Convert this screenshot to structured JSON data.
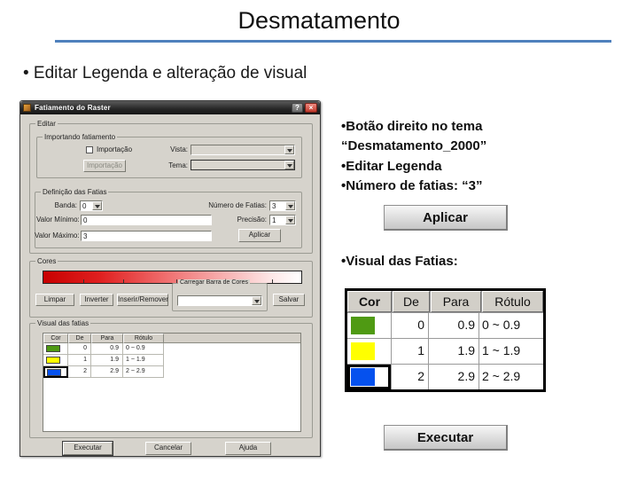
{
  "slide": {
    "title": "Desmatamento",
    "bullet": "• Editar Legenda e alteração de visual"
  },
  "colors": {
    "accent": "#4f81bd",
    "close_button_red": "#c0392b",
    "ramp_start": "#c80000",
    "ramp_end": "#ffffff"
  },
  "dialog": {
    "title": "Fatiamento do Raster",
    "help_label": "?",
    "close_label": "×",
    "groups": {
      "editar": "Editar",
      "importando": "Importando fatiamento",
      "definicao": "Definição das Fatias",
      "cores": "Cores",
      "carregar": "Carregar Barra de Cores",
      "visual": "Visual das fatias"
    },
    "importar": {
      "checkbox_label": "Importação",
      "button_label": "Importação",
      "vista_label": "Vista:",
      "vista_value": "",
      "tema_label": "Tema:",
      "tema_value": ""
    },
    "definicao": {
      "banda_label": "Banda:",
      "banda_value": "0",
      "num_fatias_label": "Número de Fatias:",
      "num_fatias_value": "3",
      "valor_min_label": "Valor Mínimo:",
      "valor_min_value": "0",
      "precisao_label": "Precisão:",
      "precisao_value": "1",
      "valor_max_label": "Valor Máximo:",
      "valor_max_value": "3",
      "aplicar_label": "Aplicar"
    },
    "cores": {
      "limpar": "Limpar",
      "inverter": "Inverter",
      "inserir": "Inserir/Remover",
      "combo_value": "",
      "salvar": "Salvar"
    },
    "table": {
      "headers": [
        "Cor",
        "De",
        "Para",
        "Rótulo"
      ],
      "rows": [
        {
          "color": "#4f9a13",
          "de": "0",
          "para": "0.9",
          "rotulo": "0 ~ 0.9"
        },
        {
          "color": "#ffff00",
          "de": "1",
          "para": "1.9",
          "rotulo": "1 ~ 1.9"
        },
        {
          "color": "#0551ee",
          "de": "2",
          "para": "2.9",
          "rotulo": "2 ~ 2.9"
        }
      ]
    },
    "footer": {
      "executar": "Executar",
      "cancelar": "Cancelar",
      "ajuda": "Ajuda"
    }
  },
  "annotations": {
    "line1": "•Botão direito no tema",
    "line2": "“Desmatamento_2000”",
    "line3": "•Editar Legenda",
    "line4": "•Número de fatias: “3”",
    "aplicar_button": "Aplicar",
    "visual_label": "•Visual das Fatias:",
    "executar_button": "Executar"
  },
  "legend_table": {
    "headers": [
      "Cor",
      "De",
      "Para",
      "Rótulo"
    ],
    "rows": [
      {
        "color": "#4f9a13",
        "de": "0",
        "para": "0.9",
        "rotulo": "0 ~ 0.9"
      },
      {
        "color": "#ffff00",
        "de": "1",
        "para": "1.9",
        "rotulo": "1 ~ 1.9"
      },
      {
        "color": "#0551ee",
        "de": "2",
        "para": "2.9",
        "rotulo": "2 ~ 2.9",
        "selected": true
      }
    ]
  }
}
